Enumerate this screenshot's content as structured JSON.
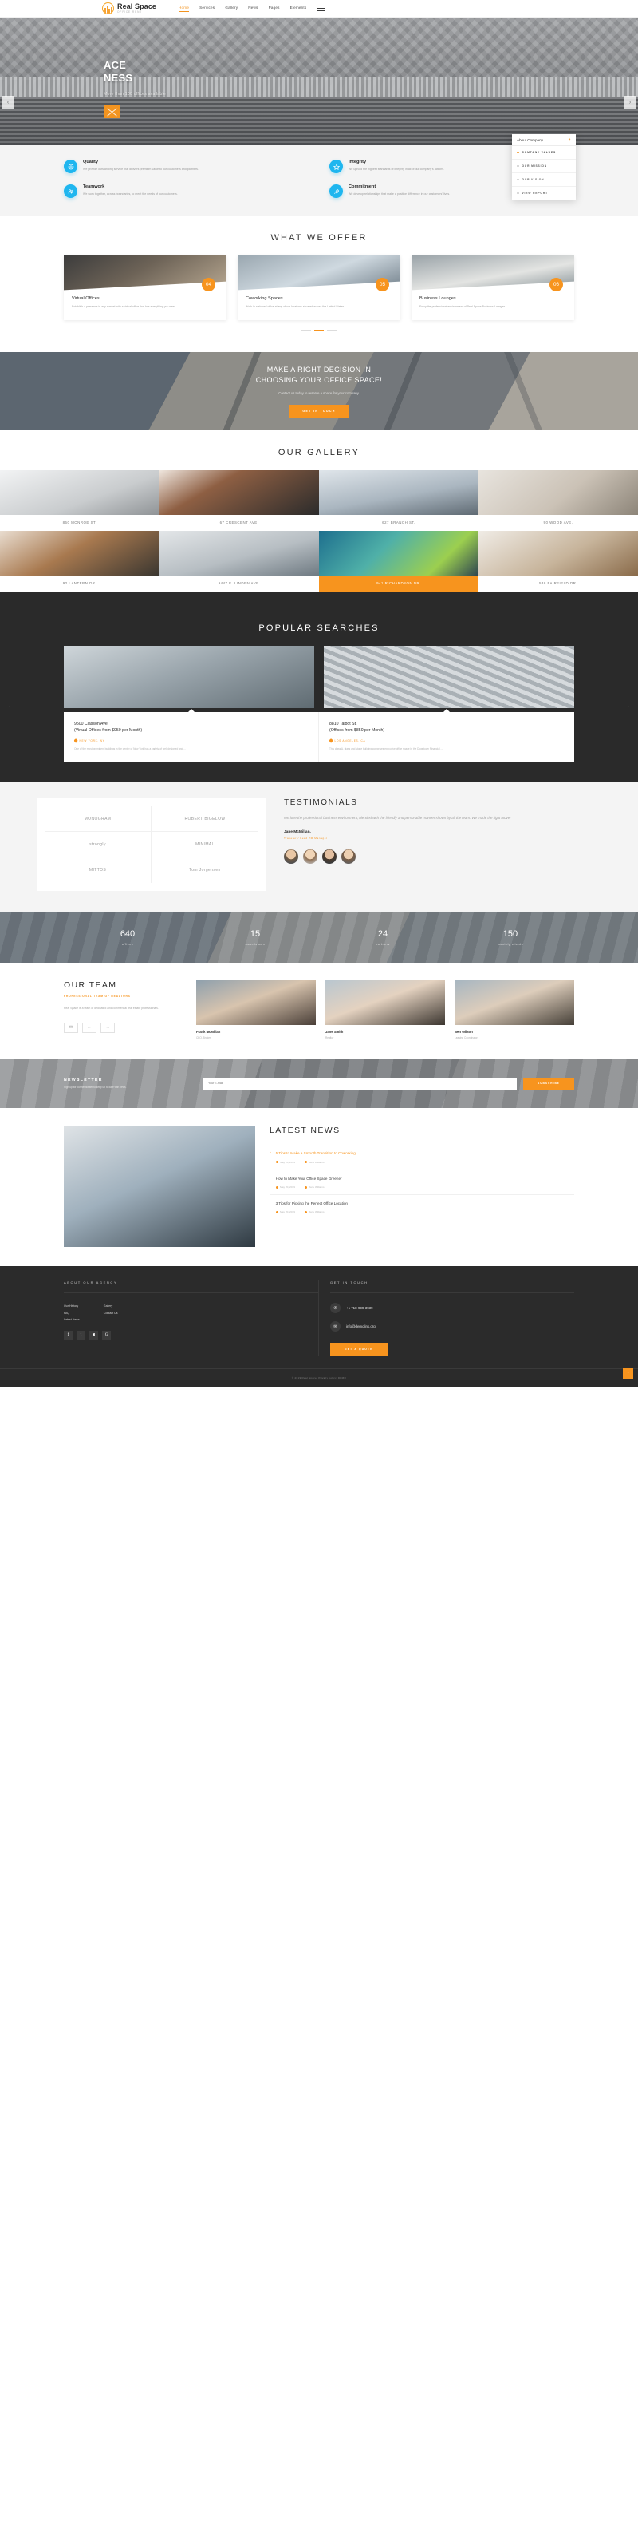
{
  "header": {
    "brand_name": "Real Space",
    "brand_sub": "OFFICE RENT",
    "nav": [
      {
        "label": "Home",
        "active": true
      },
      {
        "label": "Services",
        "active": false
      },
      {
        "label": "Gallery",
        "active": false
      },
      {
        "label": "News",
        "active": false
      },
      {
        "label": "Pages",
        "active": false
      },
      {
        "label": "Elements",
        "active": false
      }
    ],
    "menu_icon": "hamburger-icon"
  },
  "hero": {
    "title_line1": "ACE",
    "title_line2": "NESS",
    "subtitle": "More than 100 offices available",
    "play_icon": "play-button-icon",
    "prev_icon": "chevron-left-icon",
    "next_icon": "chevron-right-icon"
  },
  "about_panel": {
    "title": "About Company",
    "close_icon": "close-icon",
    "items": [
      {
        "label": "COMPANY VALUES",
        "active": true
      },
      {
        "label": "OUR MISSION",
        "active": false
      },
      {
        "label": "OUR VISION",
        "active": false
      },
      {
        "label": "VIEW REPORT",
        "active": false
      }
    ]
  },
  "features": [
    {
      "icon": "target-icon",
      "title": "Quality",
      "text": "We provide outstanding service that delivers premium value to our customers and partners."
    },
    {
      "icon": "star-icon",
      "title": "Integrity",
      "text": "We uphold the highest standards of integrity in all of our company's actions."
    },
    {
      "icon": "teamwork-icon",
      "title": "Teamwork",
      "text": "We work together, across boundaries, to meet the needs of our customers."
    },
    {
      "icon": "rocket-icon",
      "title": "Commitment",
      "text": "We develop relationships that make a positive difference in our customers' lives."
    }
  ],
  "offer": {
    "title": "WHAT WE OFFER",
    "cards": [
      {
        "number": "04",
        "title": "Virtual Offices",
        "text": "Establish a presence in any market with a virtual office that has everything you need."
      },
      {
        "number": "05",
        "title": "Coworking Spaces",
        "text": "Work in a shared office at any of our locations situated across the United States."
      },
      {
        "number": "06",
        "title": "Business Lounges",
        "text": "Enjoy the professional environment of Real Space Business Lounges."
      }
    ],
    "pagination": [
      false,
      true,
      false
    ]
  },
  "cta": {
    "line1": "MAKE A RIGHT DECISION IN",
    "line2": "CHOOSING YOUR OFFICE SPACE!",
    "subtitle": "Contact us today to reserve a space for your company.",
    "button": "GET IN TOUCH"
  },
  "gallery": {
    "title": "OUR GALLERY",
    "row1": [
      {
        "caption": "860 MONROE ST.",
        "highlight": false
      },
      {
        "caption": "67 CRESCENT AVE.",
        "highlight": false
      },
      {
        "caption": "627 BRANCH ST.",
        "highlight": false
      },
      {
        "caption": "90 WOOD AVE.",
        "highlight": false
      }
    ],
    "row2": [
      {
        "caption": "92 LANTERN DR.",
        "highlight": false
      },
      {
        "caption": "9447 E. LINDEN AVE.",
        "highlight": false
      },
      {
        "caption": "941 RICHARDSON DR.",
        "highlight": true
      },
      {
        "caption": "538 FAIRFIELD DR.",
        "highlight": false
      }
    ]
  },
  "popular": {
    "title": "POPULAR SEARCHES",
    "prev_icon": "arrow-left-icon",
    "next_icon": "arrow-right-icon",
    "cards": [
      {
        "title_line1": "9500 Classon Ave.",
        "title_line2": "(Virtual Offices from $950 per Month)",
        "location": "NEW YORK, NY",
        "description": "One of the most prominent buildings in the center of New York has a variety of well designed and ..."
      },
      {
        "title_line1": "8810 Talbot St.",
        "title_line2": "(Offices from $850 per Month)",
        "location": "LOS ANGELES, CA",
        "description": "This class A, glass and stone building comprises executive office space in the Downtown Financial ..."
      }
    ]
  },
  "partners": [
    {
      "name": "MONOGRAM"
    },
    {
      "name": "ROBERT BIGELOW"
    },
    {
      "name": "strongly"
    },
    {
      "name": "MINIMAL"
    },
    {
      "name": "MITTOS"
    },
    {
      "name": "Tom Jorgensen"
    }
  ],
  "testimonials": {
    "title": "TESTIMONIALS",
    "quote": "We love the professional business environment, blended with the friendly and personable manner shown by all the team. We made the right move!",
    "author": "Jane McMillan,",
    "role": "Traveler / Lead HR Manager",
    "avatars": [
      "avatar-1",
      "avatar-2",
      "avatar-3",
      "avatar-4"
    ]
  },
  "counters": [
    {
      "number": "640",
      "label": "offices"
    },
    {
      "number": "15",
      "label": "awards won"
    },
    {
      "number": "24",
      "label": "partners"
    },
    {
      "number": "150",
      "label": "monthly clients"
    }
  ],
  "team": {
    "title": "OUR TEAM",
    "subtitle": "PROFESSIONAL TEAM OF REALTORS",
    "text": "Real Space is a team of dedicated and commercial real estate professionals.",
    "buttons": [
      {
        "icon": "envelope-icon"
      },
      {
        "icon": "arrow-left-icon"
      },
      {
        "icon": "arrow-right-icon"
      }
    ],
    "members": [
      {
        "name": "Frank McMillan",
        "role": "CEO, Broker"
      },
      {
        "name": "Jane Smith",
        "role": "Realtor"
      },
      {
        "name": "Ben Wilson",
        "role": "Leasing Coordinator"
      }
    ]
  },
  "newsletter": {
    "title": "NEWSLETTER",
    "subtitle": "Sign up for our newsletter to keep up to date with news.",
    "placeholder": "Your E-mail",
    "button": "SUBSCRIBE"
  },
  "latest_news": {
    "title": "LATEST NEWS",
    "posts": [
      {
        "title": "5 Tips to Make a Smooth Transition to Coworking",
        "date": "May 20, 2019",
        "author": "Jane Williams",
        "active": true
      },
      {
        "title": "How to Make Your Office Space Greener",
        "date": "May 20, 2019",
        "author": "Jane Williams",
        "active": false
      },
      {
        "title": "3 Tips for Picking the Perfect Office Location",
        "date": "May 20, 2019",
        "author": "Jane Williams",
        "active": false
      }
    ]
  },
  "footer": {
    "about_head": "ABOUT OUR AGENCY",
    "links_col1": [
      "Our History",
      "FAQ",
      "Latest News"
    ],
    "links_col2": [
      "Gallery",
      "Contact Us"
    ],
    "social": [
      {
        "icon": "facebook-icon",
        "glyph": "f"
      },
      {
        "icon": "twitter-icon",
        "glyph": "t"
      },
      {
        "icon": "instagram-icon",
        "glyph": "◙"
      },
      {
        "icon": "google-plus-icon",
        "glyph": "G"
      }
    ],
    "contact_head": "GET IN TOUCH",
    "phone": "+1 718-999-3939",
    "email": "info@demolink.org",
    "quote_button": "GET A QUOTE",
    "copyright": "© 2019 Real Space. Privacy policy. DEMO",
    "totop_icon": "arrow-up-icon"
  },
  "colors": {
    "accent": "#f7941e",
    "cyan": "#1fb6ef",
    "dark": "#2b2b2b"
  }
}
